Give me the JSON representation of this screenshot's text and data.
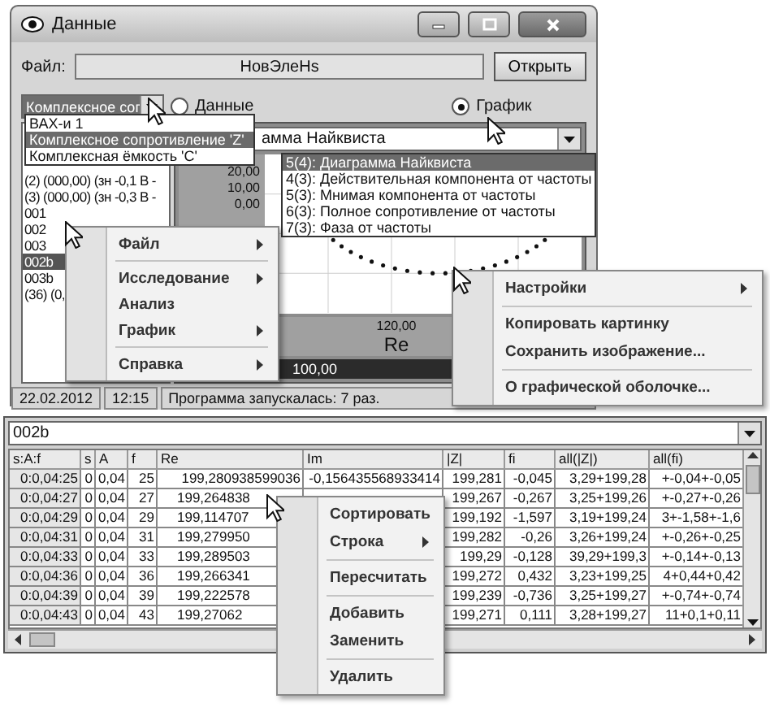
{
  "window": {
    "title": "Данные"
  },
  "file": {
    "label": "Файл:",
    "value": "НовЭлеНs",
    "open_button": "Открыть"
  },
  "mode_combo": {
    "value": "Комплексное сог",
    "expanded": true,
    "options": [
      {
        "label": "ВАХ-и 1",
        "selected": false
      },
      {
        "label": "Комплексное сопротивление 'Z'",
        "selected": true
      },
      {
        "label": "Комплексная ёмкость 'C'",
        "selected": false
      }
    ]
  },
  "view_radios": [
    {
      "label": "Данные",
      "selected": false
    },
    {
      "label": "График",
      "selected": true
    }
  ],
  "series_list": [
    {
      "label": "(2) (000,00) (зн -0,1 В -",
      "selected": false
    },
    {
      "label": "(3) (000,00) (зн -0,3 В -",
      "selected": false
    },
    {
      "label": "001",
      "selected": false
    },
    {
      "label": "002",
      "selected": false
    },
    {
      "label": "003",
      "selected": false
    },
    {
      "label": "002b",
      "selected": true
    },
    {
      "label": "003b",
      "selected": false
    },
    {
      "label": "(36) (0,",
      "selected": false
    }
  ],
  "chart_combo": {
    "value": "амма Найквиста",
    "expanded": true,
    "options": [
      {
        "label": "5(4): Диаграмма Найквиста",
        "selected": true
      },
      {
        "label": "4(3): Действительная компонента от частоты",
        "selected": false
      },
      {
        "label": "5(3): Мнимая компонента от частоты",
        "selected": false
      },
      {
        "label": "6(3): Полное сопротивление от частоты",
        "selected": false
      },
      {
        "label": "7(3): Фаза от частоты",
        "selected": false
      }
    ]
  },
  "plot": {
    "yticks": [
      "20,00",
      "10,00",
      "0,00"
    ],
    "xticks": [
      "120,00"
    ],
    "xlabel": "Re",
    "scale_value": "100,00"
  },
  "status_bar": [
    "22.02.2012",
    "12:15",
    "Программа запускалась: 7 раз."
  ],
  "context_menus": [
    {
      "items": [
        {
          "kind": "item",
          "label": "Файл",
          "submenu": true
        },
        {
          "kind": "separator"
        },
        {
          "kind": "item",
          "label": "Исследование",
          "submenu": true
        },
        {
          "kind": "item",
          "label": "Анализ",
          "submenu": false
        },
        {
          "kind": "item",
          "label": "График",
          "submenu": true
        },
        {
          "kind": "separator"
        },
        {
          "kind": "item",
          "label": "Справка",
          "submenu": true
        }
      ]
    },
    {
      "items": [
        {
          "kind": "item",
          "label": "Настройки",
          "submenu": true
        },
        {
          "kind": "separator"
        },
        {
          "kind": "item",
          "label": "Копировать картинку",
          "submenu": false
        },
        {
          "kind": "item",
          "label": "Сохранить изображение...",
          "submenu": false
        },
        {
          "kind": "separator"
        },
        {
          "kind": "item",
          "label": "О графической оболочке...",
          "submenu": false
        }
      ]
    },
    {
      "items": [
        {
          "kind": "item",
          "label": "Сортировать",
          "submenu": false
        },
        {
          "kind": "item",
          "label": "Строка",
          "submenu": true
        },
        {
          "kind": "separator"
        },
        {
          "kind": "item",
          "label": "Пересчитать",
          "submenu": false
        },
        {
          "kind": "separator"
        },
        {
          "kind": "item",
          "label": "Добавить",
          "submenu": false
        },
        {
          "kind": "item",
          "label": "Заменить",
          "submenu": false
        },
        {
          "kind": "separator"
        },
        {
          "kind": "item",
          "label": "Удалить",
          "submenu": false
        }
      ]
    }
  ],
  "table_panel": {
    "combo": "002b",
    "columns": [
      "s:A:f",
      "s",
      "A",
      "f",
      "Re",
      "Im",
      "|Z|",
      "fi",
      "all(|Z|)",
      "all(fi)"
    ],
    "rows": [
      [
        "0:0,04:25",
        "0",
        "0,04",
        "25",
        "199,280938599036",
        "-0,156435568933414",
        "199,281",
        "-0,045",
        "3,29+199,28",
        "+-0,04+-0,05"
      ],
      [
        "0:0,04:27",
        "0",
        "0,04",
        "27",
        "199,264838",
        null,
        "199,267",
        "-0,267",
        "3,25+199,26",
        "+-0,27+-0,26"
      ],
      [
        "0:0,04:29",
        "0",
        "0,04",
        "29",
        "199,114707",
        null,
        "199,192",
        "-1,597",
        "3,19+199,24",
        "3+-1,58+-1,6"
      ],
      [
        "0:0,04:31",
        "0",
        "0,04",
        "31",
        "199,279950",
        null,
        "199,282",
        "-0,26",
        "3,26+199,24",
        "+-0,26+-0,25"
      ],
      [
        "0:0,04:33",
        "0",
        "0,04",
        "33",
        "199,289503",
        null,
        "199,29",
        "-0,128",
        "39,29+199,3",
        "+-0,14+-0,13"
      ],
      [
        "0:0,04:36",
        "0",
        "0,04",
        "36",
        "199,266341",
        null,
        "199,272",
        "0,432",
        "3,23+199,25",
        "4+0,44+0,42"
      ],
      [
        "0:0,04:39",
        "0",
        "0,04",
        "39",
        "199,222578",
        null,
        "199,239",
        "-0,736",
        "3,25+199,27",
        "+-0,74+-0,74"
      ],
      [
        "0:0,04:43",
        "0",
        "0,04",
        "43",
        "199,27062",
        null,
        "199,271",
        "0,111",
        "3,28+199,27",
        "11+0,1+0,11"
      ]
    ]
  }
}
